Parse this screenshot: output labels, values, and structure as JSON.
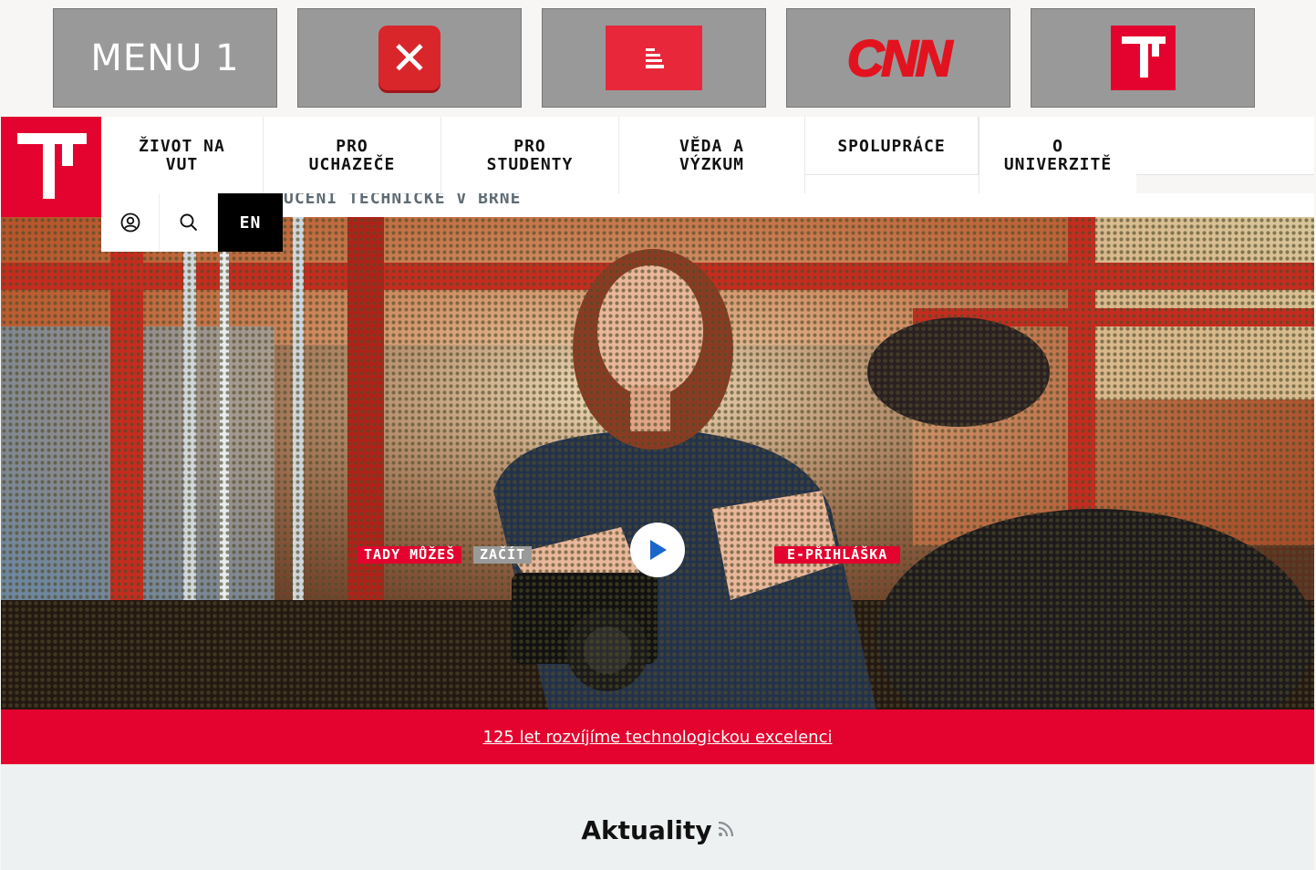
{
  "shortcuts": {
    "menu_label": "MENU 1",
    "tiles": [
      "close-app",
      "ct24",
      "cnn",
      "vut"
    ],
    "cnn_logo": "CNN"
  },
  "header": {
    "nav": [
      {
        "label": "ŽIVOT NA VUT"
      },
      {
        "label": "PRO UCHAZEČE"
      },
      {
        "label": "PRO STUDENTY"
      },
      {
        "label": "VĚDA A VÝZKUM"
      },
      {
        "label": "SPOLUPRÁCE"
      },
      {
        "label": "O UNIVERZITĚ"
      }
    ],
    "strip_text": "UČENÍ TECHNICKÉ V BRNĚ",
    "lang": "EN",
    "icons": [
      "user-icon",
      "search-icon"
    ]
  },
  "hero": {
    "cta_left_a": "TADY MŮŽEŠ",
    "cta_left_b": "ZAČÍT",
    "cta_right": "E-PŘIHLÁŠKA",
    "play": "play-icon"
  },
  "banner": {
    "link": "125 let rozvíjíme technologickou excelenci"
  },
  "news": {
    "title": "Aktuality",
    "icon": "rss-icon"
  },
  "colors": {
    "brand_red": "#e4032e",
    "tile_gray": "#999999",
    "cnn_red": "#e2131f"
  }
}
